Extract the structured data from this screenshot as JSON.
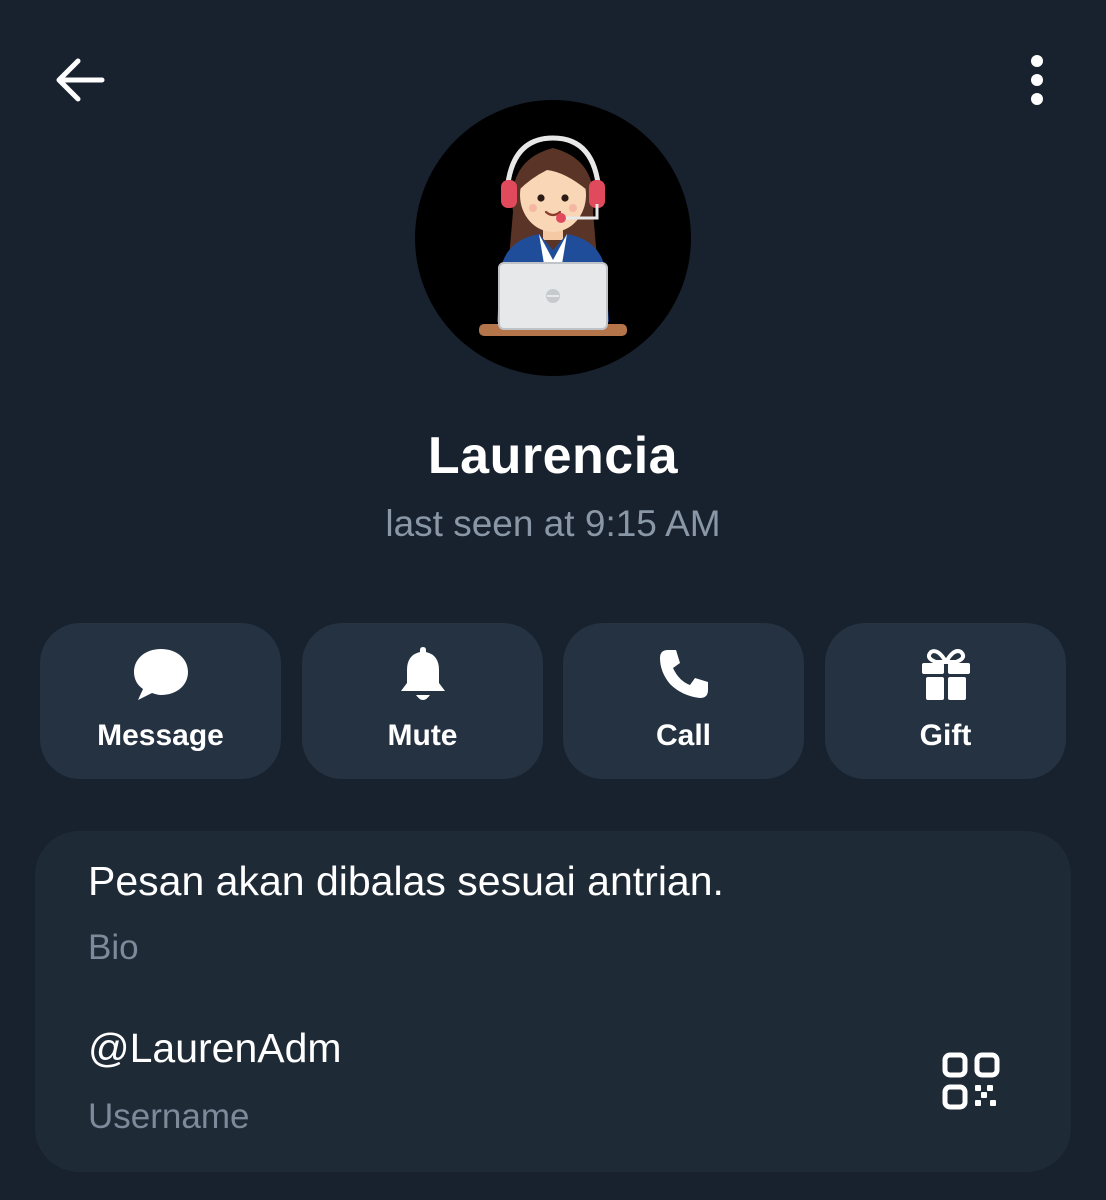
{
  "header": {
    "back_icon": "arrow-left-icon",
    "menu_icon": "more-vertical-icon"
  },
  "profile": {
    "avatar_description_icon": "support-agent-avatar",
    "name": "Laurencia",
    "status": "last seen at 9:15 AM"
  },
  "actions": [
    {
      "label": "Message",
      "icon": "chat-bubble-icon"
    },
    {
      "label": "Mute",
      "icon": "bell-icon"
    },
    {
      "label": "Call",
      "icon": "phone-icon"
    },
    {
      "label": "Gift",
      "icon": "gift-icon"
    }
  ],
  "info": {
    "bio": {
      "value": "Pesan akan dibalas sesuai antrian.",
      "label": "Bio"
    },
    "username": {
      "value": "@LaurenAdm",
      "label": "Username",
      "icon": "qr-code-icon"
    }
  },
  "colors": {
    "background": "#18222e",
    "card": "#1f2a37",
    "button": "#243241",
    "secondary_text": "#8a97a6"
  }
}
